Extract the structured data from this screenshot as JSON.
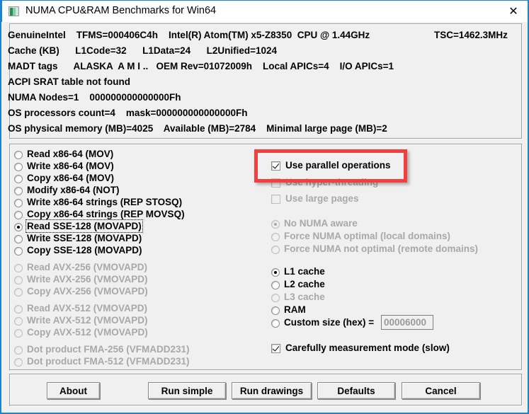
{
  "window": {
    "title": "NUMA CPU&RAM Benchmarks for Win64",
    "icon": "app-icon",
    "close_label": "✕"
  },
  "info_panel": {
    "lines": [
      "GenuineIntel    TFMS=000406C4h    Intel(R) Atom(TM) x5-Z8350  CPU @ 1.44GHz",
      "Cache (KB)      L1Code=32      L1Data=24      L2Unified=1024",
      "MADT tags      ALASKA  A M I ..   OEM Rev=01072009h    Local APICs=4    I/O APICs=1",
      "ACPI SRAT table not found",
      "NUMA Nodes=1    000000000000000Fh",
      "OS processors count=4    mask=000000000000000Fh",
      "OS physical memory (MB)=4025    Available (MB)=2784    Minimal large page (MB)=2"
    ],
    "tsc": "TSC=1462.3MHz"
  },
  "benchmarks": {
    "items": [
      {
        "label": "Read x86-64 (MOV)",
        "selected": false,
        "disabled": false
      },
      {
        "label": "Write x86-64 (MOV)",
        "selected": false,
        "disabled": false
      },
      {
        "label": "Copy x86-64 (MOV)",
        "selected": false,
        "disabled": false
      },
      {
        "label": "Modify x86-64 (NOT)",
        "selected": false,
        "disabled": false
      },
      {
        "label": "Write x86-64 strings (REP STOSQ)",
        "selected": false,
        "disabled": false
      },
      {
        "label": "Copy x86-64 strings (REP MOVSQ)",
        "selected": false,
        "disabled": false
      },
      {
        "label": "Read SSE-128 (MOVAPD)",
        "selected": true,
        "disabled": false
      },
      {
        "label": "Write SSE-128 (MOVAPD)",
        "selected": false,
        "disabled": false
      },
      {
        "label": "Copy SSE-128 (MOVAPD)",
        "selected": false,
        "disabled": false
      },
      {
        "label": "Read AVX-256 (VMOVAPD)",
        "selected": false,
        "disabled": true
      },
      {
        "label": "Write AVX-256 (VMOVAPD)",
        "selected": false,
        "disabled": true
      },
      {
        "label": "Copy AVX-256 (VMOVAPD)",
        "selected": false,
        "disabled": true
      },
      {
        "label": "Read AVX-512 (VMOVAPD)",
        "selected": false,
        "disabled": true
      },
      {
        "label": "Write AVX-512 (VMOVAPD)",
        "selected": false,
        "disabled": true
      },
      {
        "label": "Copy AVX-512 (VMOVAPD)",
        "selected": false,
        "disabled": true
      },
      {
        "label": "Dot product FMA-256 (VFMADD231)",
        "selected": false,
        "disabled": true
      },
      {
        "label": "Dot product FMA-512 (VFMADD231)",
        "selected": false,
        "disabled": true
      }
    ]
  },
  "parallel_options": {
    "items": [
      {
        "label": "Use parallel operations",
        "checked": true,
        "disabled": false
      },
      {
        "label": "Use hyper-threading",
        "checked": false,
        "disabled": true
      },
      {
        "label": "Use large pages",
        "checked": false,
        "disabled": true
      }
    ]
  },
  "numa_options": {
    "items": [
      {
        "label": "No NUMA aware",
        "selected": true,
        "disabled": true
      },
      {
        "label": "Force NUMA optimal (local domains)",
        "selected": false,
        "disabled": true
      },
      {
        "label": "Force NUMA not optimal (remote domains)",
        "selected": false,
        "disabled": true
      }
    ]
  },
  "target_options": {
    "items": [
      {
        "label": "L1 cache",
        "selected": true,
        "disabled": false
      },
      {
        "label": "L2 cache",
        "selected": false,
        "disabled": false
      },
      {
        "label": "L3 cache",
        "selected": false,
        "disabled": true
      },
      {
        "label": "RAM",
        "selected": false,
        "disabled": false
      },
      {
        "label": "Custom size (hex) =",
        "selected": false,
        "disabled": false
      }
    ],
    "custom_size_value": "00006000"
  },
  "careful_mode": {
    "label": "Carefully measurement mode (slow)",
    "checked": true
  },
  "buttons": {
    "about": "About",
    "run_simple": "Run simple",
    "run_drawings": "Run drawings",
    "defaults": "Defaults",
    "cancel": "Cancel"
  },
  "annotation": {
    "color": "#f3403f",
    "target": "Use parallel operations"
  }
}
